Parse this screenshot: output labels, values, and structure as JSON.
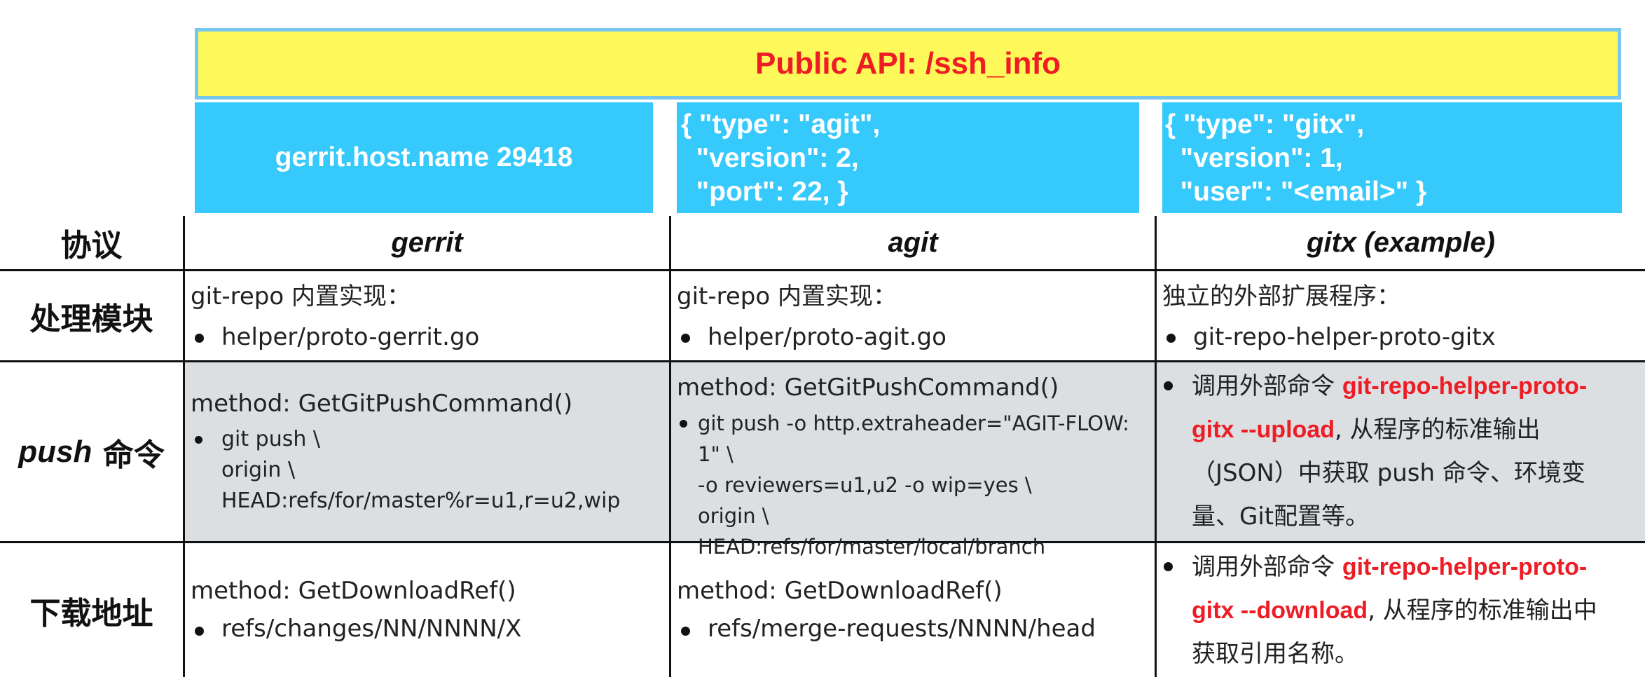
{
  "banner": {
    "title": "Public API: /ssh_info"
  },
  "responses": {
    "gerrit": "gerrit.host.name 29418",
    "agit": [
      "{ \"type\": \"agit\",",
      "  \"version\": 2,",
      "  \"port\": 22, }"
    ],
    "gitx": [
      "{ \"type\": \"gitx\",",
      "  \"version\": 1,",
      "  \"user\": \"<email>\" }"
    ]
  },
  "rows": {
    "protocol": "协议",
    "module": "处理模块",
    "push_em": "push",
    "push_rest": " 命令",
    "download": "下载地址"
  },
  "columns": {
    "gerrit": "gerrit",
    "agit": "agit",
    "gitx": "gitx (example)"
  },
  "module": {
    "gerrit": {
      "line1": "git-repo 内置实现：",
      "bullet": "helper/proto-gerrit.go"
    },
    "agit": {
      "line1": "git-repo 内置实现：",
      "bullet": "helper/proto-agit.go"
    },
    "gitx": {
      "line1": "独立的外部扩展程序：",
      "bullet": "git-repo-helper-proto-gitx"
    }
  },
  "push": {
    "gerrit": {
      "method": "method: GetGitPushCommand()",
      "lines": [
        "git push \\",
        "origin \\",
        "HEAD:refs/for/master%r=u1,r=u2,wip"
      ]
    },
    "agit": {
      "method": "method: GetGitPushCommand()",
      "lines": [
        "git push -o http.extraheader=\"AGIT-FLOW: 1\" \\",
        "-o reviewers=u1,u2  -o wip=yes \\",
        "origin \\",
        "HEAD:refs/for/master/local/branch"
      ]
    },
    "gitx": {
      "pre": "调用外部命令 ",
      "cmd1": "git-repo-helper-proto-",
      "cmd2": "gitx  --upload",
      "post1": ", 从程序的标准输出",
      "line3": "（JSON）中获取 push 命令、环境变",
      "line4": "量、Git配置等。"
    }
  },
  "download": {
    "gerrit": {
      "method": "method: GetDownloadRef()",
      "bullet": "refs/changes/NN/NNNN/X"
    },
    "agit": {
      "method": "method: GetDownloadRef()",
      "bullet": "refs/merge-requests/NNNN/head"
    },
    "gitx": {
      "pre": "调用外部命令 ",
      "cmd1": "git-repo-helper-proto-",
      "cmd2": "gitx  --download",
      "post1": ", 从程序的标准输出中",
      "line3": "获取引用名称。"
    }
  }
}
